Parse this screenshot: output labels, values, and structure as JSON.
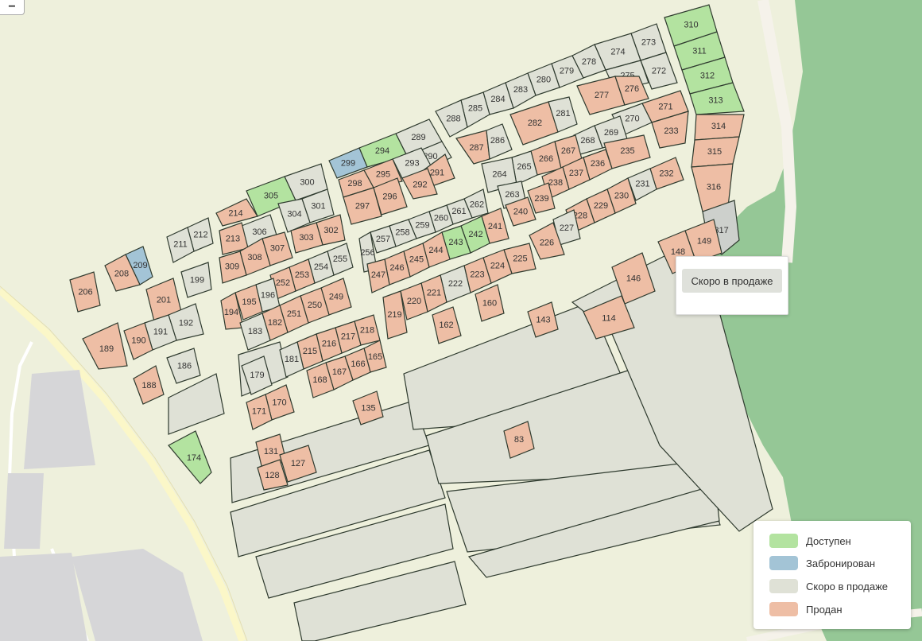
{
  "colors": {
    "available": "#b3e3a0",
    "reserved": "#a3c4d6",
    "coming_soon": "#dfe1d6",
    "sold": "#eebea5",
    "selected": "#cdd0cc",
    "background": "#eef0dc",
    "forest": "#95c796",
    "road": "#f5f2ea",
    "highway": "#fbf7c8",
    "building": "#d6d6d8",
    "stroke": "#2e3a2e"
  },
  "zoom": {
    "label": "−"
  },
  "tooltip": {
    "label": "Скоро в продаже"
  },
  "legend": {
    "items": [
      {
        "label": "Доступен",
        "status": "available"
      },
      {
        "label": "Забронирован",
        "status": "reserved"
      },
      {
        "label": "Скоро в продаже",
        "status": "coming_soon"
      },
      {
        "label": "Продан",
        "status": "sold"
      }
    ]
  },
  "plots": [
    {
      "n": "310",
      "s": "available"
    },
    {
      "n": "311",
      "s": "available"
    },
    {
      "n": "312",
      "s": "available"
    },
    {
      "n": "313",
      "s": "available"
    },
    {
      "n": "314",
      "s": "sold"
    },
    {
      "n": "315",
      "s": "sold"
    },
    {
      "n": "316",
      "s": "sold"
    },
    {
      "n": "317",
      "s": "selected"
    },
    {
      "n": "273",
      "s": "coming_soon"
    },
    {
      "n": "274",
      "s": "coming_soon"
    },
    {
      "n": "272",
      "s": "coming_soon"
    },
    {
      "n": "275",
      "s": "coming_soon"
    },
    {
      "n": "278",
      "s": "coming_soon"
    },
    {
      "n": "279",
      "s": "coming_soon"
    },
    {
      "n": "280",
      "s": "coming_soon"
    },
    {
      "n": "283",
      "s": "coming_soon"
    },
    {
      "n": "284",
      "s": "coming_soon"
    },
    {
      "n": "285",
      "s": "coming_soon"
    },
    {
      "n": "288",
      "s": "coming_soon"
    },
    {
      "n": "277",
      "s": "sold"
    },
    {
      "n": "276",
      "s": "sold"
    },
    {
      "n": "282",
      "s": "sold"
    },
    {
      "n": "281",
      "s": "coming_soon"
    },
    {
      "n": "287",
      "s": "sold"
    },
    {
      "n": "286",
      "s": "coming_soon"
    },
    {
      "n": "289",
      "s": "coming_soon"
    },
    {
      "n": "294",
      "s": "available"
    },
    {
      "n": "290",
      "s": "coming_soon"
    },
    {
      "n": "293",
      "s": "coming_soon"
    },
    {
      "n": "291",
      "s": "sold"
    },
    {
      "n": "292",
      "s": "sold"
    },
    {
      "n": "299",
      "s": "reserved"
    },
    {
      "n": "295",
      "s": "sold"
    },
    {
      "n": "298",
      "s": "sold"
    },
    {
      "n": "296",
      "s": "sold"
    },
    {
      "n": "297",
      "s": "sold"
    },
    {
      "n": "300",
      "s": "coming_soon"
    },
    {
      "n": "305",
      "s": "available"
    },
    {
      "n": "301",
      "s": "coming_soon"
    },
    {
      "n": "304",
      "s": "coming_soon"
    },
    {
      "n": "302",
      "s": "sold"
    },
    {
      "n": "303",
      "s": "sold"
    },
    {
      "n": "214",
      "s": "sold"
    },
    {
      "n": "306",
      "s": "coming_soon"
    },
    {
      "n": "213",
      "s": "sold"
    },
    {
      "n": "307",
      "s": "sold"
    },
    {
      "n": "308",
      "s": "sold"
    },
    {
      "n": "309",
      "s": "sold"
    },
    {
      "n": "271",
      "s": "sold"
    },
    {
      "n": "233",
      "s": "sold"
    },
    {
      "n": "270",
      "s": "coming_soon"
    },
    {
      "n": "269",
      "s": "coming_soon"
    },
    {
      "n": "268",
      "s": "coming_soon"
    },
    {
      "n": "267",
      "s": "sold"
    },
    {
      "n": "266",
      "s": "sold"
    },
    {
      "n": "265",
      "s": "coming_soon"
    },
    {
      "n": "264",
      "s": "coming_soon"
    },
    {
      "n": "263",
      "s": "coming_soon"
    },
    {
      "n": "235",
      "s": "sold"
    },
    {
      "n": "236",
      "s": "sold"
    },
    {
      "n": "237",
      "s": "sold"
    },
    {
      "n": "238",
      "s": "sold"
    },
    {
      "n": "239",
      "s": "sold"
    },
    {
      "n": "240",
      "s": "sold"
    },
    {
      "n": "232",
      "s": "sold"
    },
    {
      "n": "231",
      "s": "coming_soon"
    },
    {
      "n": "230",
      "s": "sold"
    },
    {
      "n": "229",
      "s": "sold"
    },
    {
      "n": "228",
      "s": "sold"
    },
    {
      "n": "227",
      "s": "coming_soon"
    },
    {
      "n": "226",
      "s": "sold"
    },
    {
      "n": "262",
      "s": "coming_soon"
    },
    {
      "n": "261",
      "s": "coming_soon"
    },
    {
      "n": "260",
      "s": "coming_soon"
    },
    {
      "n": "259",
      "s": "coming_soon"
    },
    {
      "n": "258",
      "s": "coming_soon"
    },
    {
      "n": "257",
      "s": "coming_soon"
    },
    {
      "n": "256",
      "s": "coming_soon"
    },
    {
      "n": "241",
      "s": "sold"
    },
    {
      "n": "242",
      "s": "available"
    },
    {
      "n": "243",
      "s": "available"
    },
    {
      "n": "244",
      "s": "sold"
    },
    {
      "n": "245",
      "s": "sold"
    },
    {
      "n": "246",
      "s": "sold"
    },
    {
      "n": "247",
      "s": "sold"
    },
    {
      "n": "212",
      "s": "coming_soon"
    },
    {
      "n": "211",
      "s": "coming_soon"
    },
    {
      "n": "209",
      "s": "reserved"
    },
    {
      "n": "208",
      "s": "sold"
    },
    {
      "n": "206",
      "s": "sold"
    },
    {
      "n": "199",
      "s": "coming_soon"
    },
    {
      "n": "201",
      "s": "sold"
    },
    {
      "n": "192",
      "s": "coming_soon"
    },
    {
      "n": "191",
      "s": "coming_soon"
    },
    {
      "n": "190",
      "s": "sold"
    },
    {
      "n": "189",
      "s": "sold"
    },
    {
      "n": "186",
      "s": "coming_soon"
    },
    {
      "n": "188",
      "s": "sold"
    },
    {
      "n": "174",
      "s": "available"
    },
    {
      "n": "255",
      "s": "coming_soon"
    },
    {
      "n": "254",
      "s": "coming_soon"
    },
    {
      "n": "253",
      "s": "sold"
    },
    {
      "n": "252",
      "s": "sold"
    },
    {
      "n": "196",
      "s": "coming_soon"
    },
    {
      "n": "195",
      "s": "sold"
    },
    {
      "n": "194",
      "s": "sold"
    },
    {
      "n": "249",
      "s": "sold"
    },
    {
      "n": "250",
      "s": "sold"
    },
    {
      "n": "251",
      "s": "sold"
    },
    {
      "n": "182",
      "s": "sold"
    },
    {
      "n": "183",
      "s": "coming_soon"
    },
    {
      "n": "218",
      "s": "sold"
    },
    {
      "n": "217",
      "s": "sold"
    },
    {
      "n": "216",
      "s": "sold"
    },
    {
      "n": "215",
      "s": "sold"
    },
    {
      "n": "181",
      "s": "coming_soon"
    },
    {
      "n": "179",
      "s": "coming_soon"
    },
    {
      "n": "165",
      "s": "sold"
    },
    {
      "n": "166",
      "s": "sold"
    },
    {
      "n": "167",
      "s": "sold"
    },
    {
      "n": "168",
      "s": "sold"
    },
    {
      "n": "170",
      "s": "sold"
    },
    {
      "n": "171",
      "s": "sold"
    },
    {
      "n": "225",
      "s": "sold"
    },
    {
      "n": "224",
      "s": "sold"
    },
    {
      "n": "223",
      "s": "sold"
    },
    {
      "n": "222",
      "s": "coming_soon"
    },
    {
      "n": "221",
      "s": "sold"
    },
    {
      "n": "220",
      "s": "sold"
    },
    {
      "n": "219",
      "s": "sold"
    },
    {
      "n": "160",
      "s": "sold"
    },
    {
      "n": "162",
      "s": "sold"
    },
    {
      "n": "146",
      "s": "sold"
    },
    {
      "n": "149",
      "s": "sold"
    },
    {
      "n": "148",
      "s": "sold"
    },
    {
      "n": "114",
      "s": "sold"
    },
    {
      "n": "143",
      "s": "sold"
    },
    {
      "n": "135",
      "s": "sold"
    },
    {
      "n": "131",
      "s": "sold"
    },
    {
      "n": "127",
      "s": "sold"
    },
    {
      "n": "128",
      "s": "sold"
    },
    {
      "n": "83",
      "s": "sold"
    }
  ]
}
